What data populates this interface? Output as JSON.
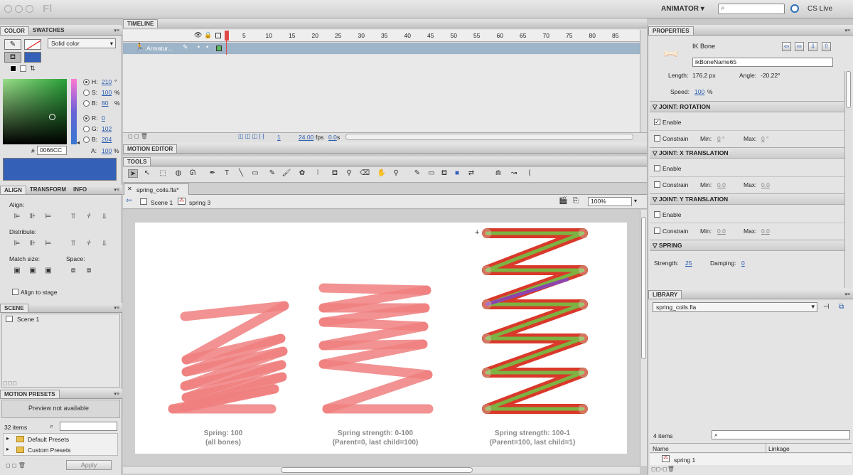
{
  "app": {
    "title": "Fl",
    "workspace": "ANIMATOR ▾",
    "cs_live": "CS Live"
  },
  "color_panel": {
    "tabs": [
      "COLOR",
      "SWATCHES"
    ],
    "fill_type": "Solid color",
    "hsb": [
      {
        "label": "H:",
        "value": "210",
        "unit": "°"
      },
      {
        "label": "S:",
        "value": "100",
        "unit": "%"
      },
      {
        "label": "B:",
        "value": "80",
        "unit": "%"
      }
    ],
    "rgb": [
      {
        "label": "R:",
        "value": "0"
      },
      {
        "label": "G:",
        "value": "102"
      },
      {
        "label": "B:",
        "value": "204"
      }
    ],
    "hex_prefix": "#",
    "hex": "0066CC",
    "alpha_label": "A:",
    "alpha": "100",
    "alpha_unit": "%",
    "swatch_color": "#3560b8"
  },
  "align_panel": {
    "tabs": [
      "ALIGN",
      "TRANSFORM",
      "INFO"
    ],
    "align_label": "Align:",
    "distribute_label": "Distribute:",
    "match_size_label": "Match size:",
    "space_label": "Space:",
    "align_to_stage": "Align to stage"
  },
  "scene_panel": {
    "tab": "SCENE",
    "items": [
      "Scene 1"
    ]
  },
  "motion_presets": {
    "tab": "MOTION PRESETS",
    "preview": "Preview not available",
    "count": "32 items",
    "folders": [
      "Default Presets",
      "Custom Presets"
    ],
    "apply": "Apply"
  },
  "timeline": {
    "tab": "TIMELINE",
    "frame_numbers": [
      "1",
      "5",
      "10",
      "15",
      "20",
      "25",
      "30",
      "35",
      "40",
      "45",
      "50",
      "55",
      "60",
      "65",
      "70",
      "75",
      "80",
      "85"
    ],
    "layer_name": "Armatur...",
    "current_frame": "1",
    "fps": "24.00",
    "fps_unit": "fps",
    "time": "0.0",
    "time_unit": "s"
  },
  "motion_editor": {
    "tab": "MOTION EDITOR"
  },
  "tools": {
    "tab": "TOOLS"
  },
  "document": {
    "tab": "spring_coils.fla*",
    "breadcrumb": [
      "Scene 1",
      "spring 3"
    ],
    "zoom": "100%"
  },
  "stage": {
    "captions": [
      {
        "line1": "Spring: 100",
        "line2": "(all bones)"
      },
      {
        "line1": "Spring strength: 0-100",
        "line2": "(Parent=0, last child=100)"
      },
      {
        "line1": "Spring strength: 100-1",
        "line2": "(Parent=100, last child=1)"
      }
    ],
    "colors": {
      "spring": "#f08080",
      "bone_green": "#7cb342",
      "bone_red": "#d9382a",
      "bone_purple": "#8e44ad"
    }
  },
  "properties": {
    "tab": "PROPERTIES",
    "object_type": "IK Bone",
    "instance_name": "ikBoneName65",
    "length_label": "Length:",
    "length_value": "176.2 px",
    "angle_label": "Angle:",
    "angle_value": "-20.22°",
    "speed_label": "Speed:",
    "speed_value": "100",
    "speed_unit": "%",
    "sections": {
      "rotation": {
        "title": "JOINT: ROTATION",
        "enable": "Enable",
        "enable_checked": true,
        "constrain": "Constrain",
        "min_label": "Min:",
        "min": "0",
        "min_unit": "°",
        "max_label": "Max:",
        "max": "0",
        "max_unit": "°"
      },
      "x_translation": {
        "title": "JOINT: X TRANSLATION",
        "enable": "Enable",
        "enable_checked": false,
        "constrain": "Constrain",
        "min_label": "Min:",
        "min": "0.0",
        "max_label": "Max:",
        "max": "0.0"
      },
      "y_translation": {
        "title": "JOINT: Y TRANSLATION",
        "enable": "Enable",
        "enable_checked": false,
        "constrain": "Constrain",
        "min_label": "Min:",
        "min": "0.0",
        "max_label": "Max:",
        "max": "0.0"
      },
      "spring": {
        "title": "SPRING",
        "strength_label": "Strength:",
        "strength": "25",
        "damping_label": "Damping:",
        "damping": "0"
      }
    }
  },
  "library": {
    "tab": "LIBRARY",
    "document": "spring_coils.fla",
    "count": "4 items",
    "col_name": "Name",
    "col_linkage": "Linkage",
    "items": [
      "spring 1"
    ]
  }
}
